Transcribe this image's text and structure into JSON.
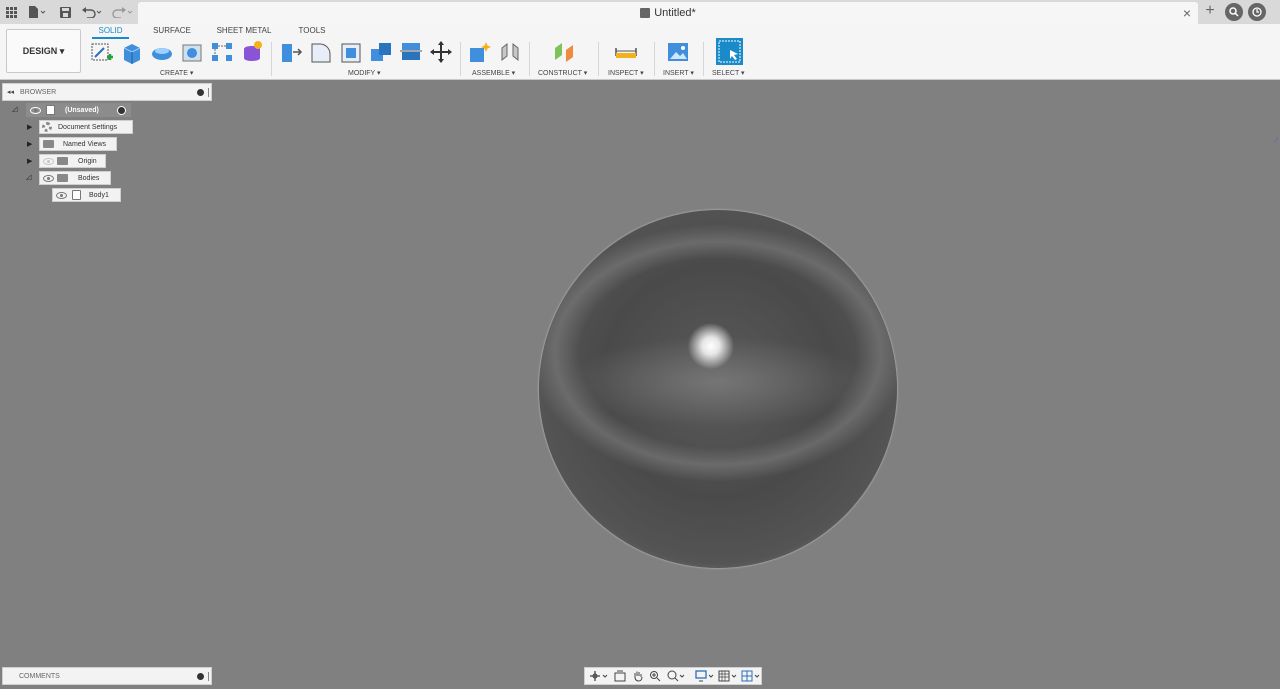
{
  "window": {
    "title": "Untitled*",
    "close_glyph": "×",
    "plus_glyph": "+"
  },
  "toolbar": {
    "workspace": "DESIGN ▾",
    "tabs": [
      "SOLID",
      "SURFACE",
      "SHEET METAL",
      "TOOLS"
    ],
    "groups": {
      "create": "CREATE ▾",
      "modify": "MODIFY ▾",
      "assemble": "ASSEMBLE ▾",
      "construct": "CONSTRUCT ▾",
      "inspect": "INSPECT ▾",
      "insert": "INSERT ▾",
      "select": "SELECT ▾"
    },
    "accent": "#1a8ac9"
  },
  "browser": {
    "title": "BROWSER",
    "root": "(Unsaved)",
    "items": [
      "Document Settings",
      "Named Views",
      "Origin",
      "Bodies",
      "Body1"
    ]
  },
  "comments": {
    "title": "COMMENTS"
  },
  "viewport": {
    "background": "#808080",
    "object": "sphere"
  }
}
